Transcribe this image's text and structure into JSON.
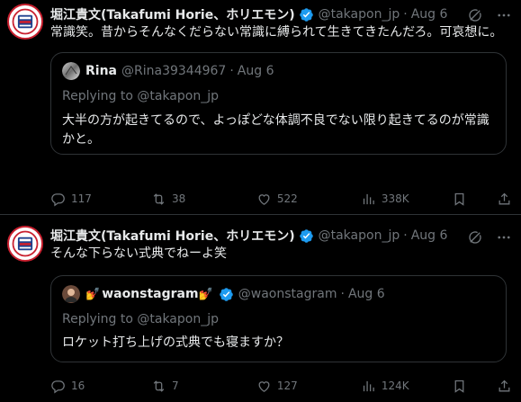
{
  "colors": {
    "background": "#000000",
    "text": "#e7e9ea",
    "muted": "#71767b",
    "border": "#2f3336",
    "verified": "#1d9bf0"
  },
  "tweets": [
    {
      "author_name": "堀江貴文(Takafumi Horie、ホリエモン)",
      "handle": "@takapon_jp",
      "separator": "·",
      "date": "Aug 6",
      "text": "常識笑。昔からそんなくだらない常識に縛られて生きてきたんだろ。可哀想に。",
      "quote": {
        "author_name": "Rina",
        "handle": "@Rina39344967",
        "separator": "·",
        "date": "Aug 6",
        "replying_to": "Replying to @takapon_jp",
        "text": "大半の方が起きてるので、よっぽどな体調不良でない限り起きてるのが常識かと。"
      },
      "stats": {
        "replies": "117",
        "retweets": "38",
        "likes": "522",
        "views": "338K"
      }
    },
    {
      "author_name": "堀江貴文(Takafumi Horie、ホリエモン)",
      "handle": "@takapon_jp",
      "separator": "·",
      "date": "Aug 6",
      "text": "そんな下らない式典でねーよ笑",
      "quote": {
        "author_name": "waonstagram",
        "emoji_left": "💅",
        "emoji_right": "💅",
        "handle": "@waonstagram",
        "separator": "·",
        "date": "Aug 6",
        "replying_to": "Replying to @takapon_jp",
        "text": "ロケット打ち上げの式典でも寝ますか？"
      },
      "stats": {
        "replies": "16",
        "retweets": "7",
        "likes": "127",
        "views": "124K"
      }
    }
  ],
  "icons": {
    "verified": "verified-badge-icon",
    "grok": "grok-icon",
    "more": "more-icon",
    "reply": "reply-icon",
    "retweet": "retweet-icon",
    "like": "heart-icon",
    "views": "views-icon",
    "bookmark": "bookmark-icon",
    "share": "share-icon"
  }
}
